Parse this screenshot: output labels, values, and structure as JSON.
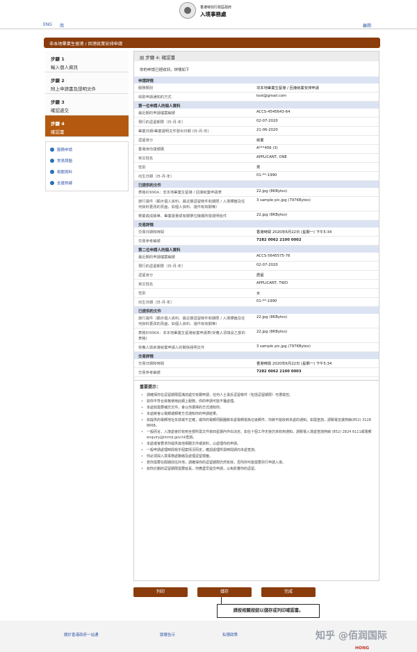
{
  "header": {
    "logo_line1": "香港特別行政區政府",
    "logo_line2": "入境事務處"
  },
  "topnav": {
    "lang_eng": "ENG",
    "lang_simp": "简",
    "back_link": "離開"
  },
  "page_title": "非本地畢業生留港 / 回港就業安排申請",
  "sidebar": {
    "steps": [
      {
        "title": "步驟 1",
        "desc": "輸入個人資訊"
      },
      {
        "title": "步驟 2",
        "desc": "附上申請書及證明文件"
      },
      {
        "title": "步驟 3",
        "desc": "確認遞交"
      },
      {
        "title": "步驟 4",
        "desc": "確認書"
      }
    ],
    "links": [
      "服務申請",
      "常見問題",
      "相關資料",
      "支援熱線"
    ]
  },
  "main": {
    "heading": "步驟 4: 確認書",
    "intro": "你的申請已經收到，詳情如下",
    "sections": [
      {
        "title": "申請詳情",
        "rows": [
          [
            "服務類別",
            "非本地畢業生留港 / 回港就業安排申請"
          ],
          [
            "收取申請通知的方式",
            "test@gmail.com"
          ]
        ]
      },
      {
        "title": "第一位申請人的個人資料",
        "rows": [
          [
            "最近期的申請檔案編號",
            "ACCS-4545643-64"
          ],
          [
            "現行的逗留期限（日-月-年）",
            "02-07-2020"
          ],
          [
            "畢業日期/畢業證明文件發出日期 (日-月-年)",
            "21-06-2020"
          ],
          [
            "逗留身分",
            "就業"
          ],
          [
            "香港身份證號碼",
            "A***456 (3)"
          ],
          [
            "英文姓名",
            "APPLICANT, ONE"
          ],
          [
            "性別",
            "男"
          ],
          [
            "出生日期（日-月-年）",
            "01-**-1990"
          ]
        ]
      },
      {
        "title": "已提供的文件",
        "rows": [
          [
            "表格ID990A：非本地畢業生留港 / 回港就業申請表",
            "22.jpg (8KBytes)"
          ],
          [
            "旅行證件（顯示個人資料、最近期逗留條件和期限 / 入境標籤及任何資料更改的頁面，如個人資料、證件有效期等）",
            "3 sample pic.jpg (797KBytes)"
          ],
          [
            "學業或成績單、畢業證書或有關學位機構所發證明信件",
            "22.jpg (8KBytes)"
          ]
        ]
      },
      {
        "title": "交易詳情",
        "rows": [
          [
            "交易日期和時間",
            "香港時間 2020年6月22日 (星期一) 下午5:34"
          ],
          [
            "交易參考編號",
            "7282 0062 2100 0002"
          ]
        ]
      },
      {
        "title": "第二位申請人的個人資料",
        "rows": [
          [
            "最近期的申請檔案編號",
            "ACCS-5645575-76"
          ],
          [
            "現行的逗留期限（日-月-年）",
            "02-07-2020"
          ],
          [
            "逗留身分",
            "居留"
          ],
          [
            "英文姓名",
            "APPLICANT, TWO"
          ],
          [
            "性別",
            "女"
          ],
          [
            "出生日期（日-月-年）",
            "01-**-1990"
          ]
        ]
      },
      {
        "title": "已提供的文件",
        "rows": [
          [
            "旅行證件（顯示個人資料、最近期逗留條件和期限 / 入境標籤及任何資料更改的頁面，如個人資料、證件有效期等）",
            "22.jpg (8KBytes)"
          ],
          [
            "表格ID990A：非本地畢業生留港就業申請表(受養人須填妥乙部的表格)",
            "22.jpg (8KBytes)"
          ],
          [
            "受養人與來港就業申請人的關係證明文件",
            "3 sample pic.jpg (797KBytes)"
          ]
        ]
      },
      {
        "title": "交易詳情",
        "rows": [
          [
            "交易日期和時間",
            "香港時間 2020年6月22日 (星期一) 下午5:34"
          ],
          [
            "交易參考編號",
            "7282 0062 2100 0003"
          ]
        ]
      }
    ],
    "notes_title": "重要提示：",
    "notes": [
      "請確保你在逗留期限屆滿前遞交有關申請，任何人士違反逗留條件（包括逗留期限）可遭檢控。",
      "如你不符合資格使用此網上服務，你的申請可能不獲處理。",
      "本處如需要補交文件，會以你選擇的方式通知你。",
      "本處將會以電郵或郵寄方式通知你的申請結果。",
      "如提供的電郵地址失效或不正確，或你的電郵伺服器將本處電郵視為垃圾郵件，你將不能收到本處的通知。如需查詢，請致電支援熱線(852) 3128 8668。",
      "一般而言，入境處會於收到全部所需文件後四星期內作出決定。如在十個工作天後仍未收到通知，請致電入境處查詢熱線 (852) 2824 6111或電郵enquiry@immd.gov.hk查詢。",
      "本處或會要求你提供其他相關文件或資料，以處理你的申請。",
      "一般申請處理時間視乎個案情況而定，確認處理所需時間請向本處查詢。",
      "你必須與入境事務處聯絡及處理逗留標籤。",
      "若你需要在假期前往外地，請確保你的逗留期限仍然有效，否則你可能需要另行申請入境。",
      "如你計劃的逗留期限需要延長，你應盡早提交申請，以免影響你的逗留。"
    ]
  },
  "buttons": {
    "print": "列印",
    "save": "儲存",
    "done": "完成"
  },
  "tooltip": "請按相關按鈕以儲存或列印確認書。",
  "footer": {
    "links": [
      "關於香港政府一站通",
      "版權告示",
      "私隱政策"
    ]
  },
  "watermark": "知乎 @佰润国际",
  "corner_tag": "HONG"
}
